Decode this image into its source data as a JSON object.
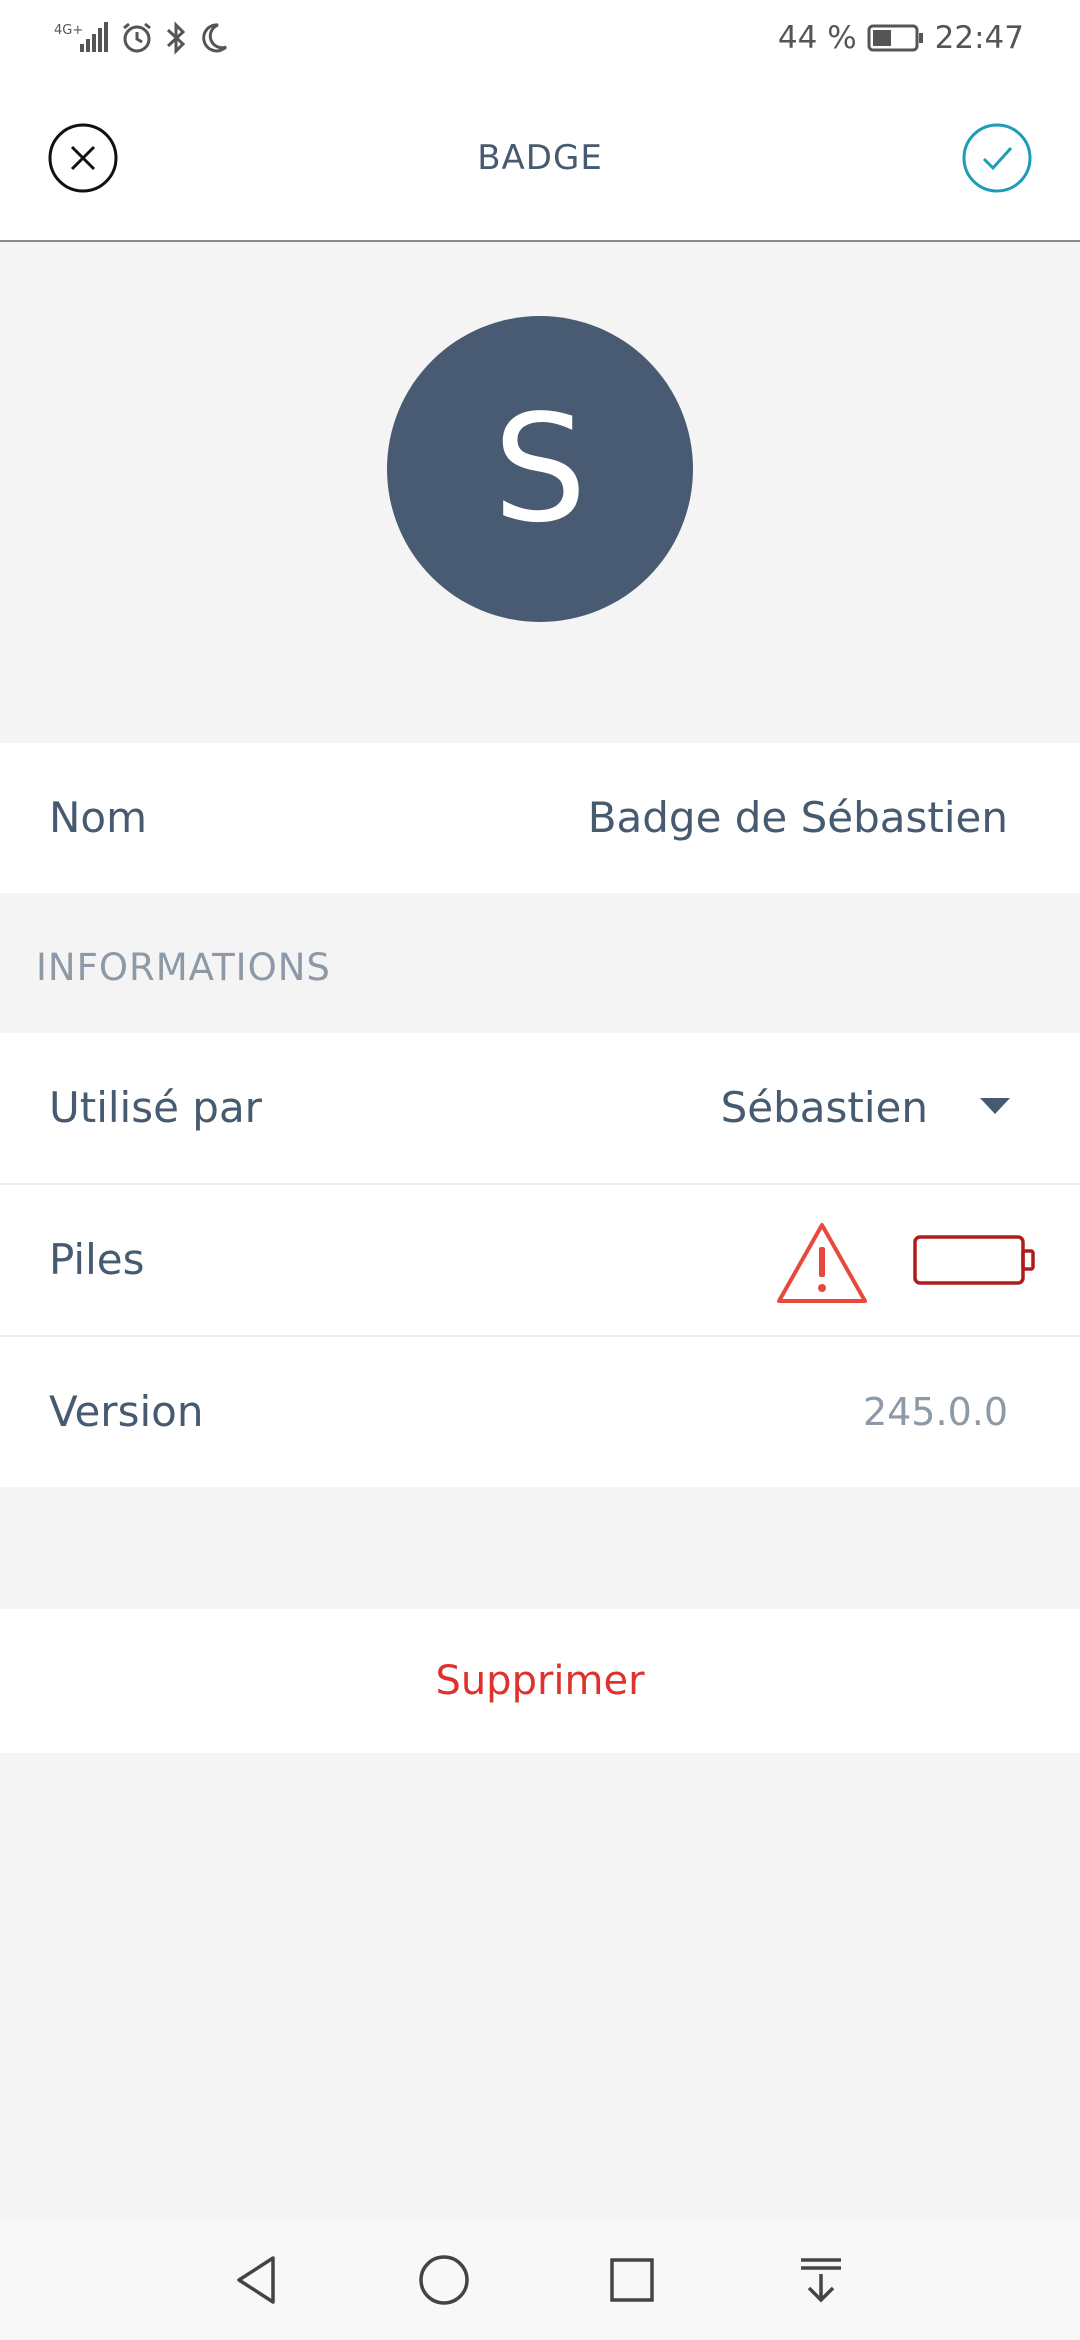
{
  "status_bar": {
    "network": "4G+",
    "battery_percent": "44 %",
    "battery_level": 0.44,
    "time": "22:47",
    "icons": [
      "signal-icon",
      "alarm-icon",
      "bluetooth-icon",
      "moon-icon",
      "battery-icon"
    ]
  },
  "app_bar": {
    "title": "BADGE",
    "close_icon": "close-icon",
    "confirm_icon": "check-icon",
    "accent_color": "#1e9bb8"
  },
  "avatar": {
    "initial": "S",
    "color": "#485b72"
  },
  "name_row": {
    "label": "Nom",
    "value": "Badge de Sébastien"
  },
  "info_section": {
    "header": "INFORMATIONS",
    "used_by": {
      "label": "Utilisé par",
      "value": "Sébastien",
      "dropdown_icon": "caret-down-icon"
    },
    "batteries": {
      "label": "Piles",
      "warning_icon": "warning-icon",
      "battery_icon": "battery-empty-icon",
      "warning_color": "#e8493e",
      "battery_color": "#b01c1c"
    },
    "version": {
      "label": "Version",
      "value": "245.0.0"
    }
  },
  "delete": {
    "label": "Supprimer",
    "color": "#e0322d"
  },
  "nav_bar": {
    "icons": [
      "back-icon",
      "home-icon",
      "recents-icon",
      "notifications-pull-icon"
    ]
  }
}
